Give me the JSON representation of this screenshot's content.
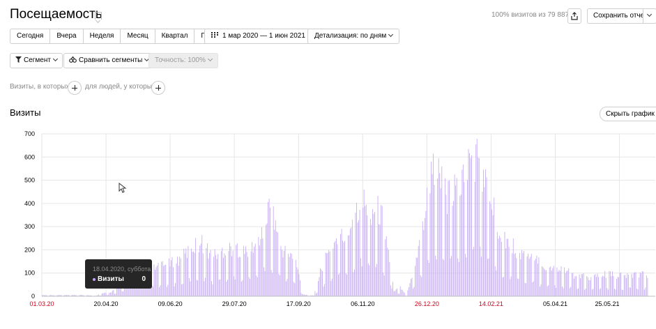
{
  "header": {
    "title": "Посещаемость",
    "sample_note": "100% визитов из 79 887",
    "save_label": "Сохранить отчет"
  },
  "periods": [
    "Сегодня",
    "Вчера",
    "Неделя",
    "Месяц",
    "Квартал",
    "Год"
  ],
  "date_range": "1 мар 2020 — 1 июн 2021",
  "detail": "Детализация: по дням",
  "segments": {
    "segment_label": "Сегмент",
    "compare_label": "Сравнить сегменты",
    "accuracy_label": "Точность: 100%"
  },
  "filters": {
    "visits_label": "Визиты, в которых",
    "people_label": "для людей, у которых"
  },
  "chart_section": {
    "title": "Визиты",
    "hide_label": "Скрыть график"
  },
  "tooltip": {
    "date": "18.04.2020, суббота",
    "metric": "Визиты",
    "value": "0"
  },
  "colors": {
    "bar": "#c4a9f5",
    "bar_dark": "#a98ae8",
    "weekend_label": "#d0021b",
    "grid": "#e6e6e6"
  },
  "chart_data": {
    "type": "bar",
    "x_start": "01.03.20",
    "x_end": "01.06.21",
    "ylim": [
      0,
      700
    ],
    "y_ticks": [
      0,
      100,
      200,
      300,
      400,
      500,
      600,
      700
    ],
    "x_ticks": [
      {
        "label": "01.03.20",
        "weekend": true
      },
      {
        "label": "20.04.20",
        "weekend": false
      },
      {
        "label": "09.06.20",
        "weekend": false
      },
      {
        "label": "29.07.20",
        "weekend": false
      },
      {
        "label": "17.09.20",
        "weekend": false
      },
      {
        "label": "06.11.20",
        "weekend": false
      },
      {
        "label": "26.12.20",
        "weekend": true
      },
      {
        "label": "14.02.21",
        "weekend": true
      },
      {
        "label": "05.04.21",
        "weekend": false
      },
      {
        "label": "25.05.21",
        "weekend": false
      }
    ],
    "series": [
      {
        "name": "Визиты",
        "anchors": [
          [
            0,
            5
          ],
          [
            40,
            5
          ],
          [
            50,
            2
          ],
          [
            55,
            10
          ],
          [
            65,
            20
          ],
          [
            72,
            40
          ],
          [
            80,
            95
          ],
          [
            90,
            120
          ],
          [
            100,
            115
          ],
          [
            110,
            125
          ],
          [
            120,
            140
          ],
          [
            130,
            160
          ],
          [
            140,
            210
          ],
          [
            150,
            230
          ],
          [
            160,
            170
          ],
          [
            170,
            200
          ],
          [
            180,
            210
          ],
          [
            190,
            190
          ],
          [
            200,
            220
          ],
          [
            205,
            260
          ],
          [
            213,
            380
          ],
          [
            218,
            330
          ],
          [
            225,
            200
          ],
          [
            232,
            185
          ],
          [
            238,
            150
          ],
          [
            245,
            8
          ],
          [
            255,
            3
          ],
          [
            262,
            120
          ],
          [
            270,
            200
          ],
          [
            278,
            260
          ],
          [
            285,
            250
          ],
          [
            293,
            360
          ],
          [
            300,
            420
          ],
          [
            307,
            360
          ],
          [
            314,
            380
          ],
          [
            320,
            330
          ],
          [
            326,
            160
          ],
          [
            330,
            20
          ],
          [
            336,
            40
          ],
          [
            342,
            6
          ],
          [
            350,
            140
          ],
          [
            358,
            320
          ],
          [
            363,
            480
          ],
          [
            368,
            560
          ],
          [
            374,
            500
          ],
          [
            380,
            420
          ],
          [
            390,
            460
          ],
          [
            396,
            520
          ],
          [
            402,
            580
          ],
          [
            408,
            600
          ],
          [
            413,
            520
          ],
          [
            420,
            430
          ],
          [
            428,
            300
          ],
          [
            436,
            240
          ],
          [
            445,
            200
          ],
          [
            455,
            170
          ],
          [
            465,
            150
          ],
          [
            475,
            120
          ],
          [
            485,
            125
          ],
          [
            500,
            90
          ],
          [
            515,
            80
          ],
          [
            530,
            95
          ],
          [
            545,
            85
          ],
          [
            557,
            100
          ],
          [
            568,
            90
          ]
        ],
        "weekend_dips": 0.35,
        "zero_days": [
          48
        ]
      }
    ]
  }
}
